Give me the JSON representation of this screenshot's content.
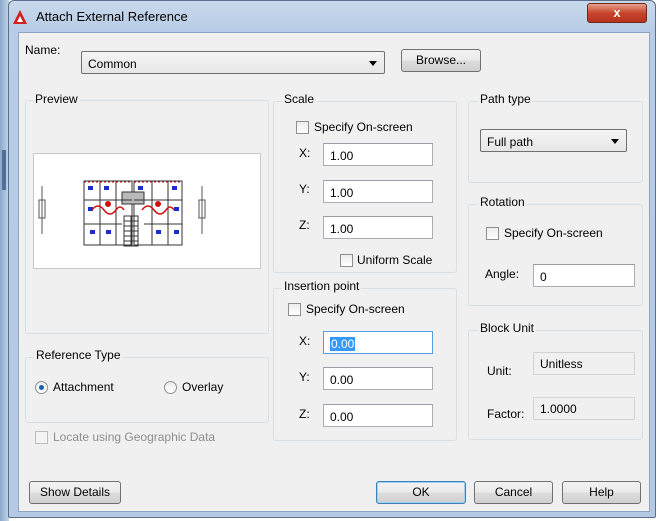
{
  "window": {
    "title": "Attach External Reference",
    "close_glyph": "x"
  },
  "name_row": {
    "label": "Name:",
    "value": "Common",
    "browse_label": "Browse..."
  },
  "preview": {
    "label": "Preview",
    "image": "floor-plan-thumbnail"
  },
  "reference_type": {
    "label": "Reference Type",
    "options": [
      {
        "label": "Attachment",
        "selected": true
      },
      {
        "label": "Overlay",
        "selected": false
      }
    ]
  },
  "geographic": {
    "label": "Locate using Geographic Data",
    "checked": false,
    "enabled": false
  },
  "scale": {
    "label": "Scale",
    "specify_on_screen": "Specify On-screen",
    "x_label": "X:",
    "x_value": "1.00",
    "y_label": "Y:",
    "y_value": "1.00",
    "z_label": "Z:",
    "z_value": "1.00",
    "uniform_scale": "Uniform Scale"
  },
  "insertion_point": {
    "label": "Insertion point",
    "specify_on_screen": "Specify On-screen",
    "x_label": "X:",
    "x_value": "0.00",
    "y_label": "Y:",
    "y_value": "0.00",
    "z_label": "Z:",
    "z_value": "0.00"
  },
  "path_type": {
    "label": "Path type",
    "value": "Full path"
  },
  "rotation": {
    "label": "Rotation",
    "specify_on_screen": "Specify On-screen",
    "angle_label": "Angle:",
    "angle_value": "0"
  },
  "block_unit": {
    "label": "Block Unit",
    "unit_label": "Unit:",
    "unit_value": "Unitless",
    "factor_label": "Factor:",
    "factor_value": "1.0000"
  },
  "buttons": {
    "show_details": "Show Details",
    "ok": "OK",
    "cancel": "Cancel",
    "help": "Help"
  },
  "colors": {
    "titlebar": "#c9d9ec",
    "close": "#c6452b",
    "dialog_bg": "#f0f0f0",
    "selection": "#3399ff",
    "autocad_red": "#d21f1f"
  }
}
